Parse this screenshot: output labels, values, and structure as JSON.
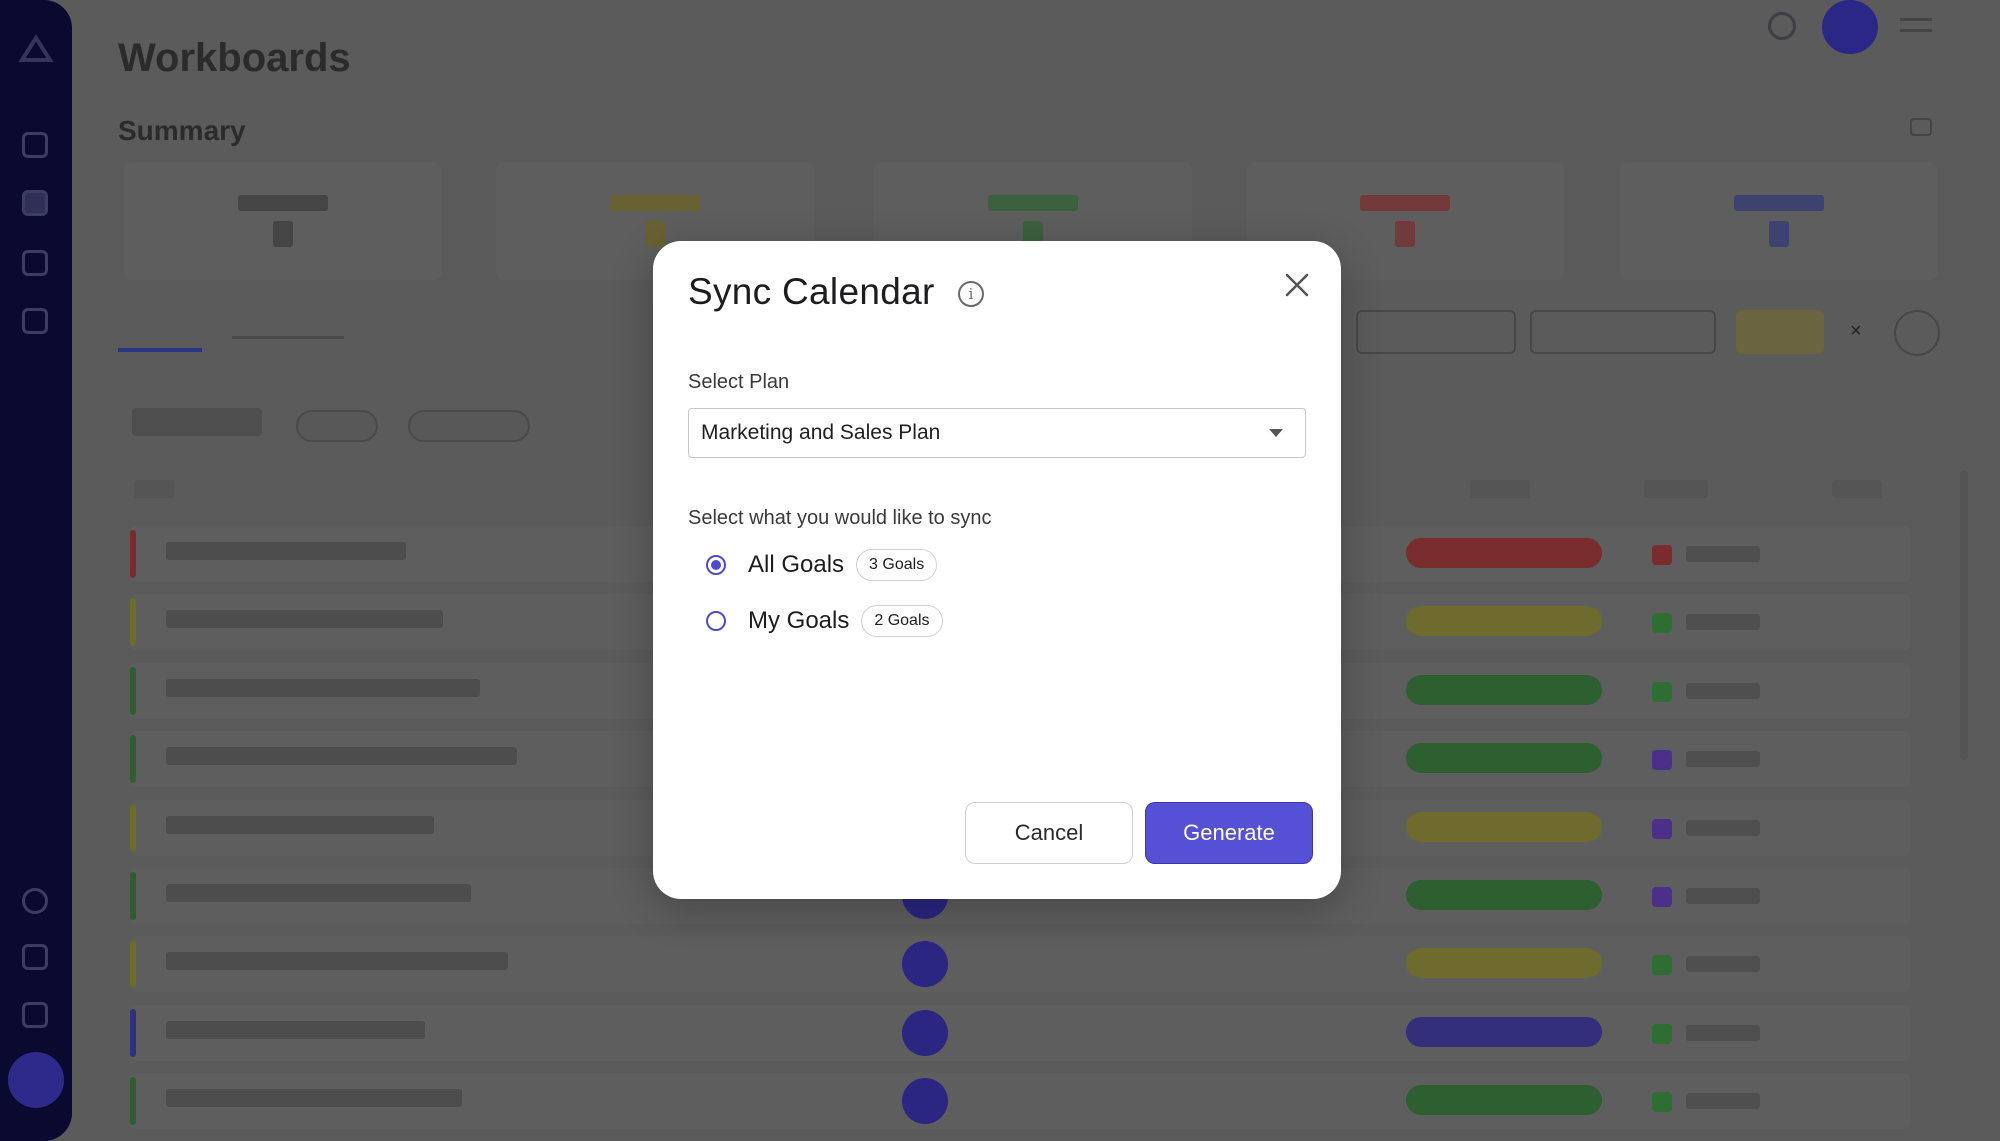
{
  "colors": {
    "accent": "#5550d6",
    "status_red": "#7a2d2d",
    "status_yellow": "#6f6a2e",
    "status_green": "#2e5f31",
    "status_blue": "#332f7a",
    "weight_green": "#2f6e33",
    "weight_purple": "#4c2f88",
    "weight_red": "#7a2b2b"
  },
  "modal": {
    "title": "Sync Calendar",
    "info_icon": "info-icon",
    "close_icon": "close-icon",
    "plan_label": "Select Plan",
    "plan_selected": "Marketing and Sales Plan",
    "sync_label": "Select what you would like to sync",
    "options": [
      {
        "label": "All Goals",
        "badge": "3 Goals",
        "selected": true
      },
      {
        "label": "My Goals",
        "badge": "2 Goals",
        "selected": false
      }
    ],
    "cancel_label": "Cancel",
    "generate_label": "Generate"
  },
  "background": {
    "page_title": "Workboards",
    "summary_title": "Summary",
    "stats": [
      {
        "color": "#3a3a3a"
      },
      {
        "color": "#6c6220"
      },
      {
        "color": "#2f6231"
      },
      {
        "color": "#7a2b2b"
      },
      {
        "color": "#2f3775"
      }
    ],
    "rows": [
      {
        "bar": "#7a2b2b",
        "status": "#7a2d2d",
        "weight_dot": "#7a2b2b"
      },
      {
        "bar": "#6f6a2e",
        "status": "#6f6a2e",
        "weight_dot": "#2f6e33"
      },
      {
        "bar": "#2e5f31",
        "status": "#2e5f31",
        "weight_dot": "#2f6e33"
      },
      {
        "bar": "#2e5f31",
        "status": "#2e5f31",
        "weight_dot": "#4c2f88"
      },
      {
        "bar": "#6f6a2e",
        "status": "#6f6a2e",
        "weight_dot": "#4c2f88"
      },
      {
        "bar": "#2e5f31",
        "status": "#2e5f31",
        "weight_dot": "#4c2f88"
      },
      {
        "bar": "#6f6a2e",
        "status": "#6f6a2e",
        "weight_dot": "#2f6e33"
      },
      {
        "bar": "#332f7a",
        "status": "#332f7a",
        "weight_dot": "#2f6e33"
      },
      {
        "bar": "#2e5f31",
        "status": "#2e5f31",
        "weight_dot": "#2f6e33"
      }
    ]
  }
}
